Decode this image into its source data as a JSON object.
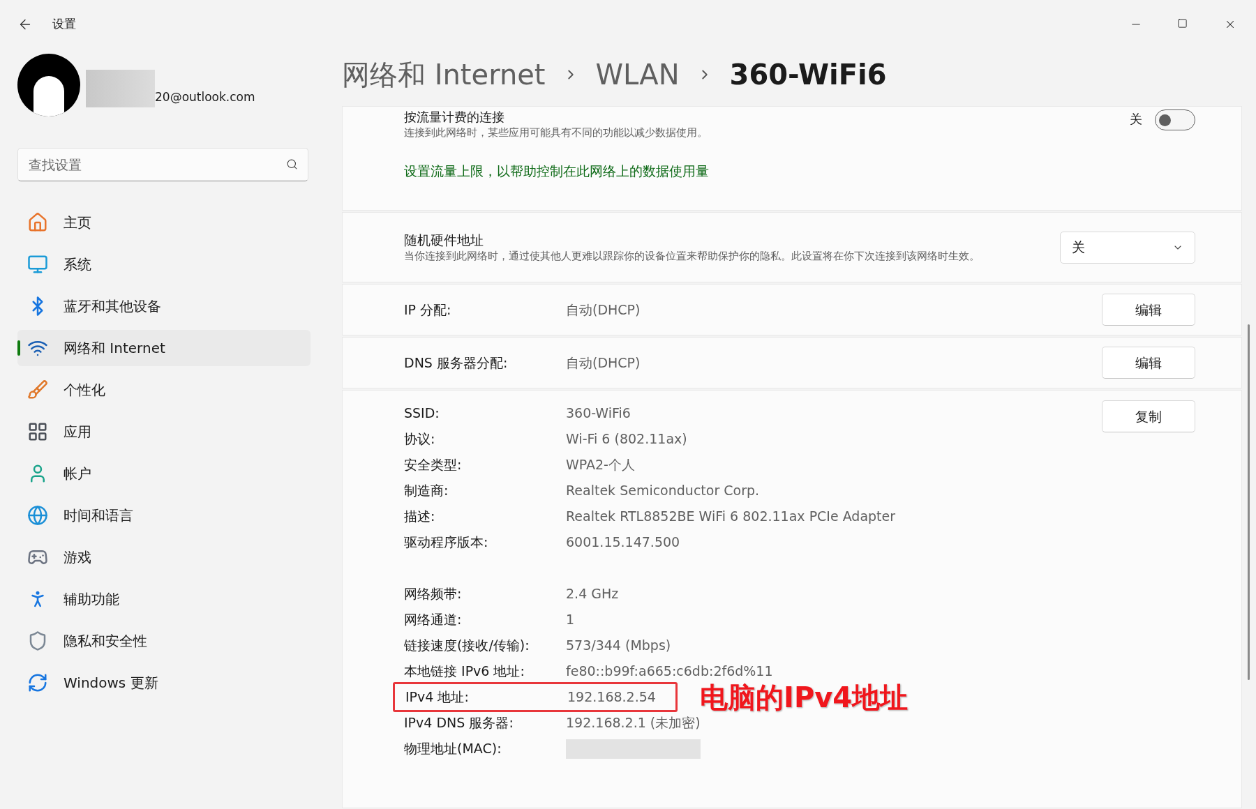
{
  "window": {
    "title": "设置"
  },
  "account": {
    "email": "20@outlook.com"
  },
  "search": {
    "placeholder": "查找设置"
  },
  "nav": [
    {
      "label": "主页",
      "selected": false
    },
    {
      "label": "系统",
      "selected": false
    },
    {
      "label": "蓝牙和其他设备",
      "selected": false
    },
    {
      "label": "网络和 Internet",
      "selected": true
    },
    {
      "label": "个性化",
      "selected": false
    },
    {
      "label": "应用",
      "selected": false
    },
    {
      "label": "帐户",
      "selected": false
    },
    {
      "label": "时间和语言",
      "selected": false
    },
    {
      "label": "游戏",
      "selected": false
    },
    {
      "label": "辅助功能",
      "selected": false
    },
    {
      "label": "隐私和安全性",
      "selected": false
    },
    {
      "label": "Windows 更新",
      "selected": false
    }
  ],
  "breadcrumb": [
    "网络和 Internet",
    "WLAN",
    "360-WiFi6"
  ],
  "metered": {
    "title": "按流量计费的连接",
    "description": "连接到此网络时，某些应用可能具有不同的功能以减少数据使用。",
    "toggle": {
      "label": "关",
      "on": false
    },
    "link": "设置流量上限，以帮助控制在此网络上的数据使用量"
  },
  "random_mac": {
    "title": "随机硬件地址",
    "description": "当你连接到此网络时，通过使其他人更难以跟踪你的设备位置来帮助保护你的隐私。此设置将在你下次连接到该网络时生效。",
    "dropdown": {
      "value": "关"
    }
  },
  "assignments": [
    {
      "label": "IP 分配:",
      "value": "自动(DHCP)",
      "button": "编辑"
    },
    {
      "label": "DNS 服务器分配:",
      "value": "自动(DHCP)",
      "button": "编辑"
    }
  ],
  "properties": {
    "button": "复制",
    "groups": [
      [
        {
          "label": "SSID:",
          "value": "360-WiFi6",
          "highlighted": false
        },
        {
          "label": "协议:",
          "value": "Wi-Fi 6 (802.11ax)",
          "highlighted": false
        },
        {
          "label": "安全类型:",
          "value": "WPA2-个人",
          "highlighted": false
        },
        {
          "label": "制造商:",
          "value": "Realtek Semiconductor Corp.",
          "highlighted": false
        },
        {
          "label": "描述:",
          "value": "Realtek RTL8852BE WiFi 6 802.11ax PCIe Adapter",
          "highlighted": false
        },
        {
          "label": "驱动程序版本:",
          "value": "6001.15.147.500",
          "highlighted": false
        }
      ],
      [
        {
          "label": "网络频带:",
          "value": "2.4 GHz",
          "highlighted": false
        },
        {
          "label": "网络通道:",
          "value": "1",
          "highlighted": false
        },
        {
          "label": "链接速度(接收/传输):",
          "value": "573/344 (Mbps)",
          "highlighted": false
        },
        {
          "label": "本地链接 IPv6 地址:",
          "value": "fe80::b99f:a665:c6db:2f6d%11",
          "highlighted": false
        },
        {
          "label": "IPv4 地址:",
          "value": "192.168.2.54",
          "highlighted": true
        },
        {
          "label": "IPv4 DNS 服务器:",
          "value": "192.168.2.1 (未加密)",
          "highlighted": false
        },
        {
          "label": "物理地址(MAC):",
          "redacted": true,
          "highlighted": false
        }
      ]
    ]
  },
  "annotation": {
    "text": "电脑的IPv4地址"
  }
}
